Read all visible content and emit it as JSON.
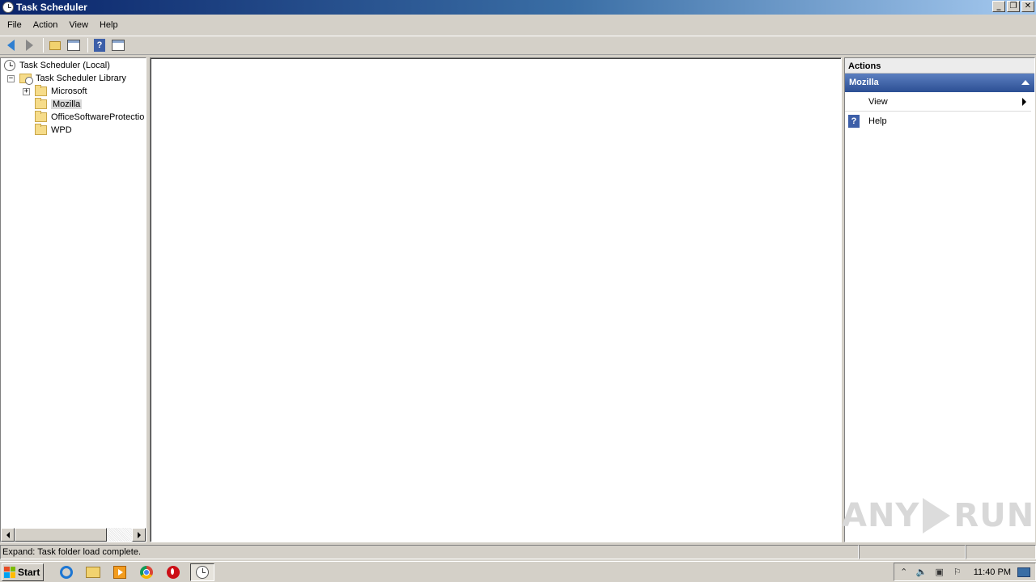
{
  "window": {
    "title": "Task Scheduler"
  },
  "menu": [
    "File",
    "Action",
    "View",
    "Help"
  ],
  "tree": {
    "root": "Task Scheduler (Local)",
    "library": "Task Scheduler Library",
    "folders": [
      "Microsoft",
      "Mozilla",
      "OfficeSoftwareProtectio",
      "WPD"
    ],
    "selected": "Mozilla"
  },
  "actions": {
    "header": "Actions",
    "section_title": "Mozilla",
    "items": [
      "View",
      "Help"
    ]
  },
  "status": {
    "text": "Expand:  Task folder load complete."
  },
  "watermark": {
    "left": "ANY",
    "right": "RUN"
  },
  "taskbar": {
    "start_label": "Start",
    "clock": "11:40 PM"
  }
}
